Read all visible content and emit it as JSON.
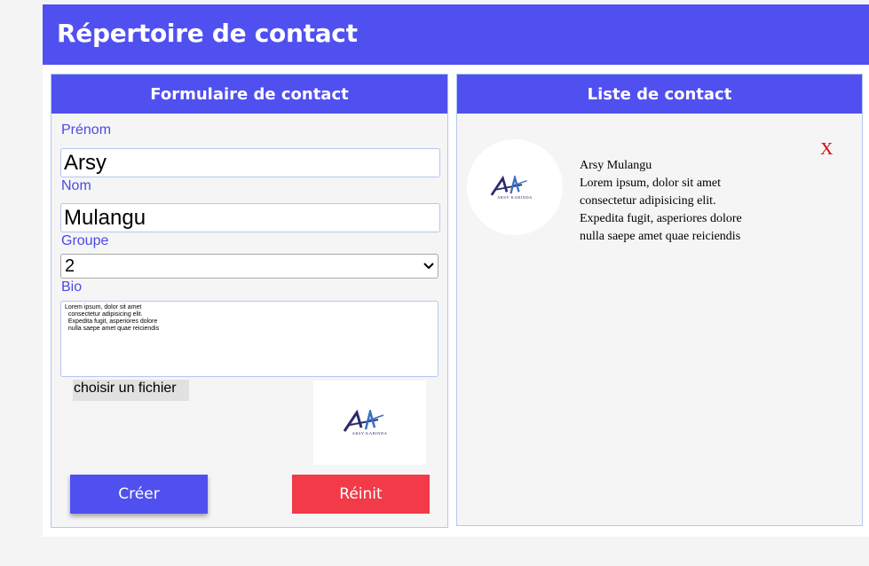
{
  "header": {
    "title": "Répertoire de contact"
  },
  "form": {
    "title": "Formulaire de contact",
    "firstname_label": "Prénom",
    "firstname_value": "Arsy",
    "lastname_label": "Nom",
    "lastname_value": "Mulangu",
    "group_label": "Groupe",
    "group_value": "2",
    "bio_label": "Bio",
    "bio_value": "Lorem ipsum, dolor sit amet\n  consectetur adipisicing elit.\n  Expedita fugit, asperiores dolore\n  nulla saepe amet quae reiciendis",
    "file_label": "choisir un fichier",
    "create_label": "Créer",
    "reset_label": "Réinit"
  },
  "list": {
    "title": "Liste de contact",
    "contacts": [
      {
        "name": "Arsy Mulangu",
        "bio": "Lorem ipsum, dolor sit amet\nconsectetur adipisicing elit.\nExpedita fugit, asperiores dolore\nnulla saepe amet quae reiciendis",
        "delete_label": "X"
      }
    ]
  },
  "logo": {
    "caption": "ARSY KABINDA"
  },
  "colors": {
    "primary": "#5050f0",
    "danger": "#f23a48",
    "label": "#4a4ae6",
    "delete": "#e00000"
  },
  "icons": {
    "logo": "ak-logo-icon",
    "select": "chevron-down-icon"
  }
}
